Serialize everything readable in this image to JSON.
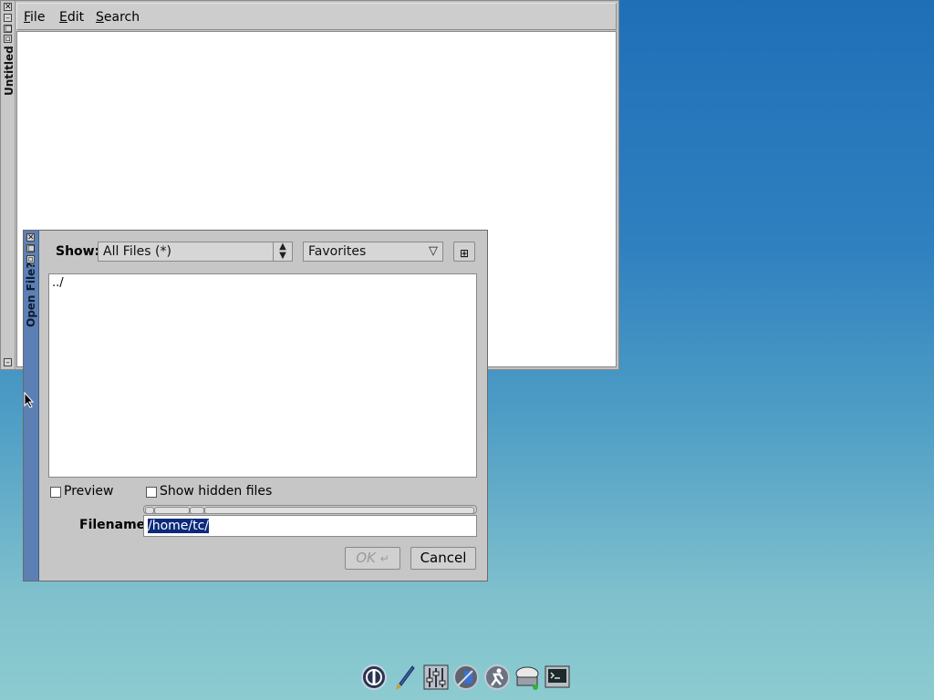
{
  "editor": {
    "title": "Untitled",
    "menu": [
      {
        "label": "File",
        "underline": "F"
      },
      {
        "label": "Edit",
        "underline": "E"
      },
      {
        "label": "Search",
        "underline": "S"
      }
    ]
  },
  "dialog": {
    "title": "Open File?",
    "show_label": "Show:",
    "filter_value": "All Files (*)",
    "favorites_value": "Favorites",
    "files": [
      "../"
    ],
    "preview_label": "Preview",
    "hidden_label": "Show hidden files",
    "filename_label": "Filename:",
    "filename_value": "/home/tc/",
    "ok_label": "OK",
    "cancel_label": "Cancel"
  },
  "taskbar": {
    "icons": [
      "power-icon",
      "paint-brush-icon",
      "control-panel-icon",
      "installer-icon",
      "run-icon",
      "mount-tool-icon",
      "terminal-icon"
    ]
  },
  "colors": {
    "dialog_sidebar": "#5d80b4",
    "selection": "#0b2a7c"
  }
}
